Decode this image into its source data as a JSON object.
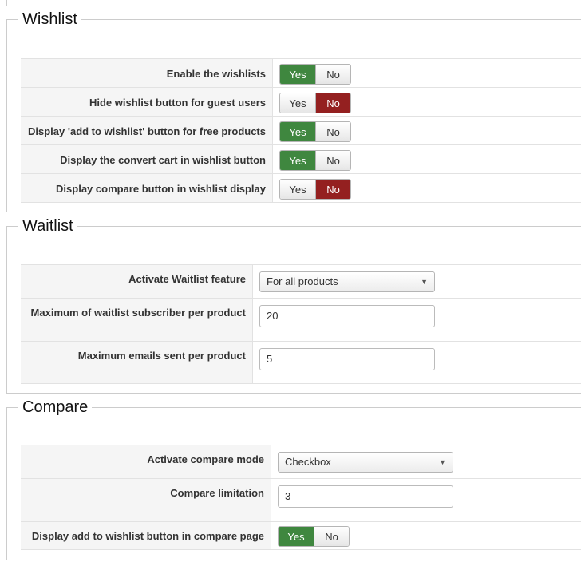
{
  "wishlist": {
    "title": "Wishlist",
    "rows": [
      {
        "label": "Enable the wishlists",
        "yes": "Yes",
        "no": "No",
        "selected": "yes"
      },
      {
        "label": "Hide wishlist button for guest users",
        "yes": "Yes",
        "no": "No",
        "selected": "no"
      },
      {
        "label": "Display 'add to wishlist' button for free products",
        "yes": "Yes",
        "no": "No",
        "selected": "yes"
      },
      {
        "label": "Display the convert cart in wishlist button",
        "yes": "Yes",
        "no": "No",
        "selected": "yes"
      },
      {
        "label": "Display compare button in wishlist display",
        "yes": "Yes",
        "no": "No",
        "selected": "no"
      }
    ]
  },
  "waitlist": {
    "title": "Waitlist",
    "activate_label": "Activate Waitlist feature",
    "activate_value": "For all products",
    "max_subscriber_label": "Maximum of waitlist subscriber per product",
    "max_subscriber_value": "20",
    "max_emails_label": "Maximum emails sent per product",
    "max_emails_value": "5"
  },
  "compare": {
    "title": "Compare",
    "mode_label": "Activate compare mode",
    "mode_value": "Checkbox",
    "limitation_label": "Compare limitation",
    "limitation_value": "3",
    "wishlist_btn_label": "Display add to wishlist button in compare page",
    "yes": "Yes",
    "no": "No",
    "selected": "yes"
  },
  "icons": {
    "dropdown": "▼"
  }
}
